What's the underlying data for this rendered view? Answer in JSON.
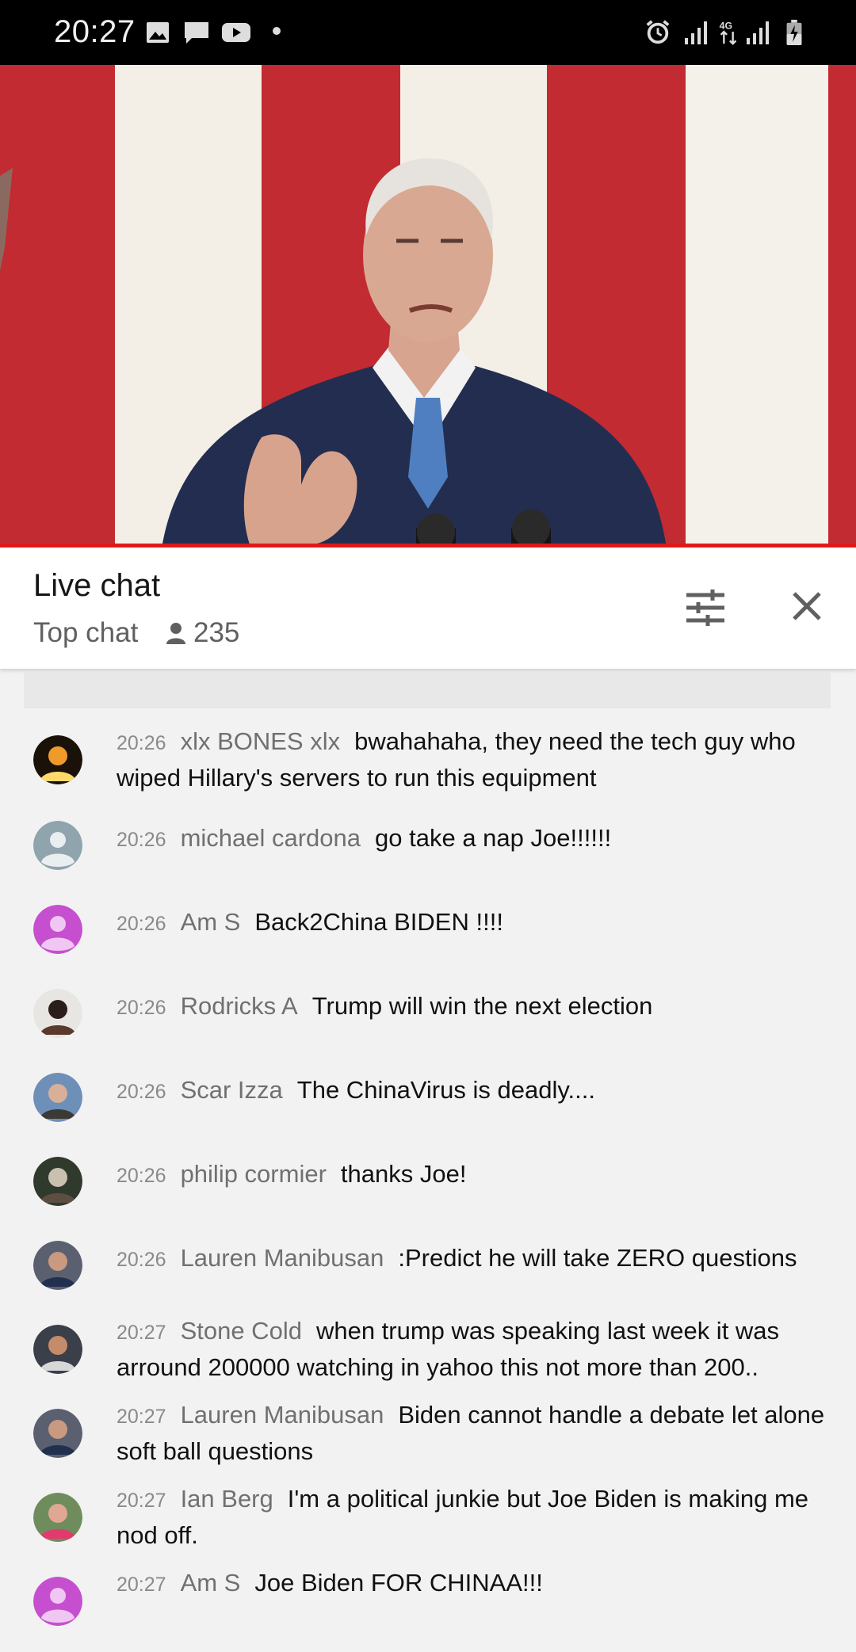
{
  "status_bar": {
    "time": "20:27",
    "left_icons": [
      "image-icon",
      "message-icon",
      "youtube-icon",
      "dot"
    ],
    "right_icons": [
      "alarm-icon",
      "signal-icon",
      "4g-data-icon",
      "signal-icon-2",
      "battery-charging-icon"
    ],
    "network_label": "4G"
  },
  "video": {
    "progress": 1.0,
    "accent_color": "#e21818"
  },
  "chat_header": {
    "title": "Live chat",
    "mode": "Top chat",
    "viewer_count": "235"
  },
  "messages": [
    {
      "time": "20:26",
      "author": "xlx BONES xlx",
      "text": "bwahahaha, they need the tech guy who wiped Hillary's servers to run this equipment",
      "avatar": "fire"
    },
    {
      "time": "20:26",
      "author": "michael cardona",
      "text": "go take a nap Joe!!!!!!",
      "avatar": "default-gray"
    },
    {
      "time": "20:26",
      "author": "Am S",
      "text": "Back2China BIDEN !!!!",
      "avatar": "default-purple"
    },
    {
      "time": "20:26",
      "author": "Rodricks A",
      "text": "Trump will win the next election",
      "avatar": "photo-suit"
    },
    {
      "time": "20:26",
      "author": "Scar Izza",
      "text": "The ChinaVirus is deadly....",
      "avatar": "photo-portrait"
    },
    {
      "time": "20:26",
      "author": "philip cormier",
      "text": "thanks Joe!",
      "avatar": "photo-beard"
    },
    {
      "time": "20:26",
      "author": "Lauren Manibusan",
      "text": ":Predict he will take ZERO questions",
      "avatar": "photo-woman"
    },
    {
      "time": "20:27",
      "author": "Stone Cold",
      "text": "when trump was speaking last week it was arround 200000 watching in yahoo this not more than 200..",
      "avatar": "photo-group"
    },
    {
      "time": "20:27",
      "author": "Lauren Manibusan",
      "text": "Biden cannot handle a debate let alone soft ball questions",
      "avatar": "photo-woman"
    },
    {
      "time": "20:27",
      "author": "Ian Berg",
      "text": "I'm a political junkie but Joe Biden is making me nod off.",
      "avatar": "photo-cap"
    },
    {
      "time": "20:27",
      "author": "Am S",
      "text": "Joe Biden FOR CHINAA!!!",
      "avatar": "default-purple"
    }
  ]
}
